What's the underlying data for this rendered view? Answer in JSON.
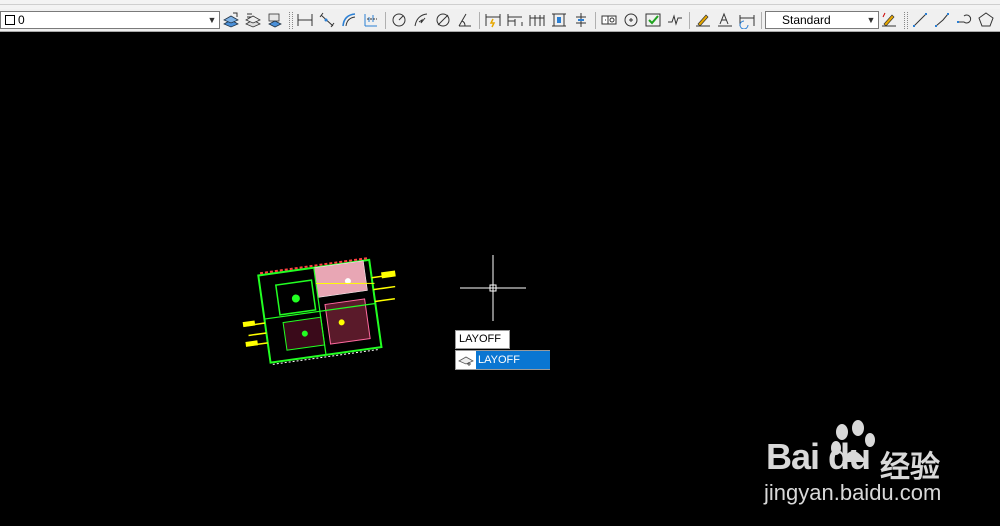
{
  "toolbar": {
    "layer_combo": {
      "value": "0"
    },
    "style_combo": {
      "value": "Standard"
    },
    "icons": [
      "layer-state-icon",
      "layer-properties-icon",
      "layer-isolate-icon",
      "linear-dim-icon",
      "aligned-dim-icon",
      "arc-length-icon",
      "ordinate-dim-icon",
      "radius-dim-icon",
      "jogged-dim-icon",
      "diameter-dim-icon",
      "angular-dim-icon",
      "quick-dim-icon",
      "baseline-dim-icon",
      "continue-dim-icon",
      "dim-space-icon",
      "dim-break-icon",
      "tolerance-icon",
      "center-mark-icon",
      "inspect-icon",
      "jogged-linear-icon",
      "dim-edit-icon",
      "dim-text-edit-icon",
      "dim-update-icon",
      "dim-style-icon",
      "line-icon",
      "polyline-icon",
      "polygon-icon",
      "rectangle-icon"
    ]
  },
  "command_input": {
    "typed": "LAYOFF"
  },
  "autocomplete": {
    "suggestion": "LAYOFF",
    "highlight_color": "#0a76d2"
  },
  "watermark": {
    "logo": "Bai du",
    "chinese": "经验",
    "url": "jingyan.baidu.com"
  },
  "colors": {
    "canvas": "#000000",
    "crosshair": "#ffffff",
    "drawing_accent": "#ffff00",
    "drawing_green": "#22ff22"
  }
}
